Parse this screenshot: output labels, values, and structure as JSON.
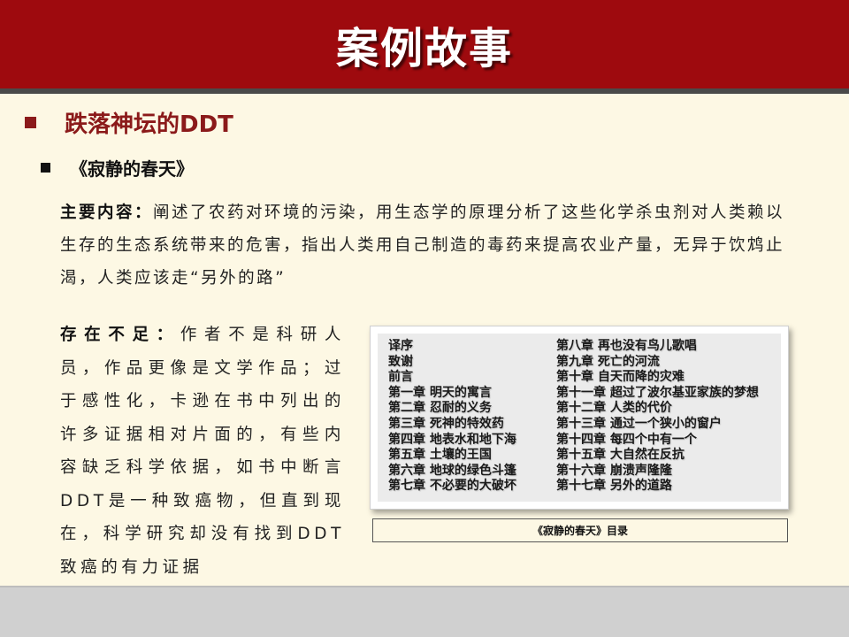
{
  "header": {
    "title": "案例故事"
  },
  "heading1": "跌落神坛的DDT",
  "heading2": "《寂静的春天》",
  "main_content": {
    "label": "主要内容：",
    "text": "阐述了农药对环境的污染，用生态学的原理分析了这些化学杀虫剂对人类赖以生存的生态系统带来的危害，指出人类用自己制造的毒药来提高农业产量，无异于饮鸩止渴，人类应该走“另外的路”"
  },
  "shortcomings": {
    "label": "存在不足：",
    "text": "作者不是科研人员，作品更像是文学作品；过于感性化，卡逊在书中列出的许多证据相对片面的，有些内容缺乏科学依据，如书中断言DDT是一种致癌物，但直到现在，科学研究却没有找到DDT致癌的有力证据"
  },
  "toc": {
    "left": [
      "译序",
      "致谢",
      "前言",
      "第一章  明天的寓言",
      "第二章  忍耐的义务",
      "第三章  死神的特效药",
      "第四章  地表水和地下海",
      "第五章  土壤的王国",
      "第六章  地球的绿色斗篷",
      "第七章  不必要的大破坏"
    ],
    "right": [
      "第八章  再也没有鸟儿歌唱",
      "第九章  死亡的河流",
      "第十章  自天而降的灾难",
      "第十一章  超过了波尔基亚家族的梦想",
      "第十二章  人类的代价",
      "第十三章  通过一个狭小的窗户",
      "第十四章  每四个中有一个",
      "第十五章  大自然在反抗",
      "第十六章  崩溃声隆隆",
      "第十七章  另外的道路"
    ],
    "caption": "《寂静的春天》目录"
  },
  "colors": {
    "header_bg": "#9e0a0e",
    "accent": "#8b1a1a",
    "page_bg": "#fdf8e4",
    "footer_bg": "#d0d0d0"
  }
}
